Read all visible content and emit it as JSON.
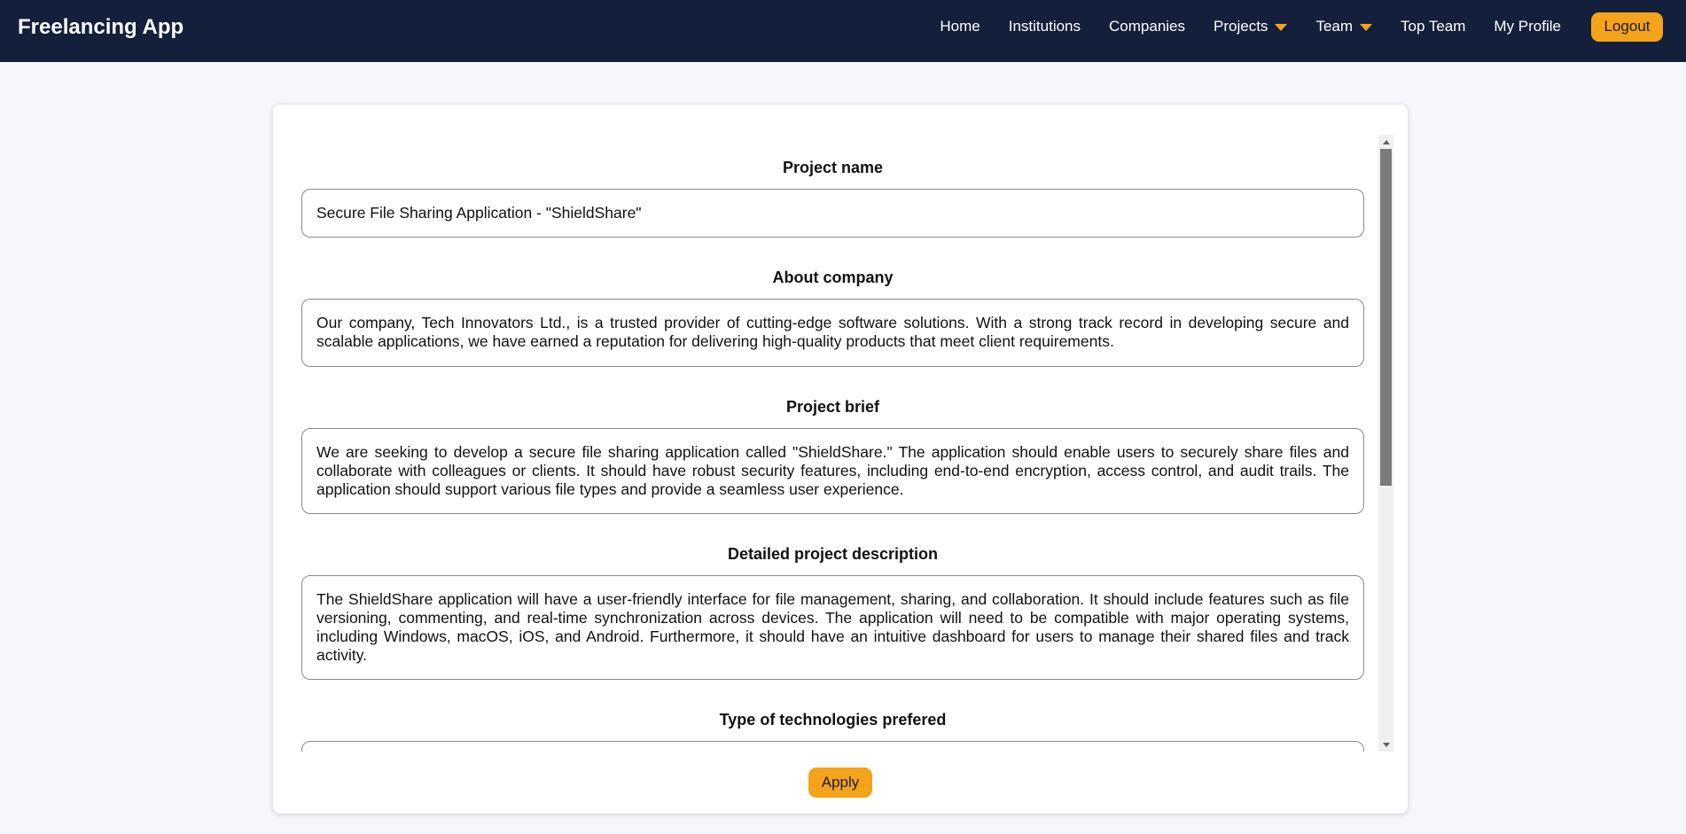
{
  "app": {
    "brand": "Freelancing App"
  },
  "nav": {
    "home": "Home",
    "institutions": "Institutions",
    "companies": "Companies",
    "projects": "Projects",
    "team": "Team",
    "top_team": "Top Team",
    "my_profile": "My Profile",
    "logout": "Logout"
  },
  "project": {
    "fields": [
      {
        "label": "Project name",
        "value": "Secure File Sharing Application - \"ShieldShare\""
      },
      {
        "label": "About company",
        "value": "Our company, Tech Innovators Ltd., is a trusted provider of cutting-edge software solutions. With a strong track record in developing secure and scalable applications, we have earned a reputation for delivering high-quality products that meet client requirements."
      },
      {
        "label": "Project brief",
        "value": "We are seeking to develop a secure file sharing application called \"ShieldShare.\" The application should enable users to securely share files and collaborate with colleagues or clients. It should have robust security features, including end-to-end encryption, access control, and audit trails. The application should support various file types and provide a seamless user experience."
      },
      {
        "label": "Detailed project description",
        "value": "The ShieldShare application will have a user-friendly interface for file management, sharing, and collaboration. It should include features such as file versioning, commenting, and real-time synchronization across devices. The application will need to be compatible with major operating systems, including Windows, macOS, iOS, and Android. Furthermore, it should have an intuitive dashboard for users to manage their shared files and track activity."
      },
      {
        "label": "Type of technologies prefered",
        "value": ""
      }
    ],
    "apply_label": "Apply"
  },
  "colors": {
    "navbar_bg": "#14203b",
    "accent": "#f5a31a",
    "page_bg": "#f5f7fc"
  }
}
